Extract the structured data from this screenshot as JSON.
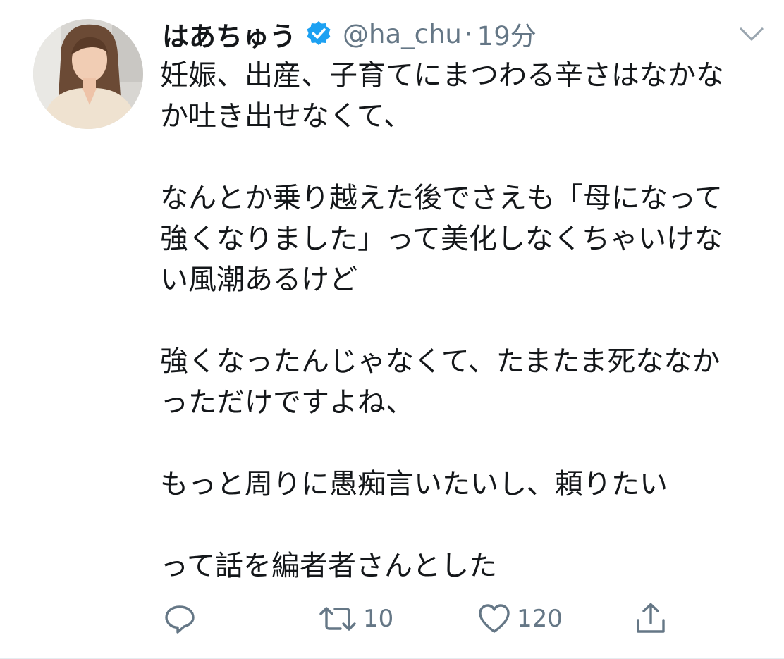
{
  "tweet": {
    "display_name": "はあちゅう",
    "handle": "@ha_chu",
    "separator": "·",
    "time": "19分",
    "paragraphs": [
      [
        "妊娠、出産、子育てにまつわる辛さはなかな",
        "か吐き出せなくて、"
      ],
      [
        "なんとか乗り越えた後でさえも「母になって",
        "強くなりました」って美化しなくちゃいけな",
        "い風潮あるけど"
      ],
      [
        "強くなったんじゃなくて、たまたま死ななか",
        "っただけですよね、"
      ],
      [
        "もっと周りに愚痴言いたいし、頼りたい"
      ],
      [
        "って話を編者者さんとした"
      ]
    ]
  },
  "actions": {
    "reply_count": "",
    "retweet_count": "10",
    "like_count": "120"
  },
  "icons": {
    "verified": "verified-badge-icon",
    "caret": "chevron-down-icon",
    "reply": "reply-icon",
    "retweet": "retweet-icon",
    "like": "heart-icon",
    "share": "share-icon"
  },
  "colors": {
    "text": "#14171a",
    "secondary": "#657786",
    "verified": "#1da1f2"
  }
}
